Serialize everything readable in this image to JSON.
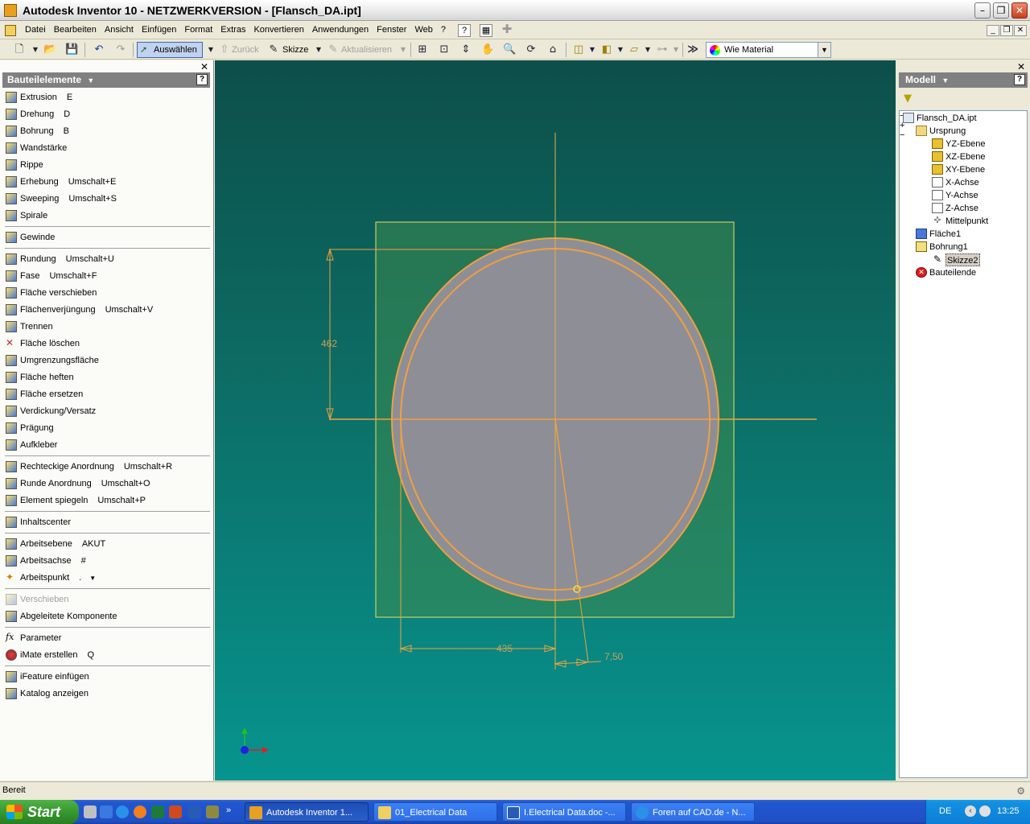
{
  "window": {
    "title": "Autodesk Inventor 10 - NETZWERKVERSION - [Flansch_DA.ipt]"
  },
  "menu": {
    "items": [
      "Datei",
      "Bearbeiten",
      "Ansicht",
      "Einfügen",
      "Format",
      "Extras",
      "Konvertieren",
      "Anwendungen",
      "Fenster",
      "Web",
      "?"
    ]
  },
  "toolbar": {
    "select_label": "Auswählen",
    "back_label": "Zurück",
    "sketch_label": "Skizze",
    "update_label": "Aktualisieren",
    "material": "Wie Material"
  },
  "left_panel": {
    "title": "Bauteilelemente",
    "items": [
      {
        "label": "Extrusion",
        "shortcut": "E"
      },
      {
        "label": "Drehung",
        "shortcut": "D"
      },
      {
        "label": "Bohrung",
        "shortcut": "B"
      },
      {
        "label": "Wandstärke",
        "shortcut": ""
      },
      {
        "label": "Rippe",
        "shortcut": ""
      },
      {
        "label": "Erhebung",
        "shortcut": "Umschalt+E"
      },
      {
        "label": "Sweeping",
        "shortcut": "Umschalt+S"
      },
      {
        "label": "Spirale",
        "shortcut": ""
      },
      {
        "label": "Gewinde",
        "shortcut": ""
      },
      {
        "label": "Rundung",
        "shortcut": "Umschalt+U"
      },
      {
        "label": "Fase",
        "shortcut": "Umschalt+F"
      },
      {
        "label": "Fläche verschieben",
        "shortcut": ""
      },
      {
        "label": "Flächenverjüngung",
        "shortcut": "Umschalt+V"
      },
      {
        "label": "Trennen",
        "shortcut": ""
      },
      {
        "label": "Fläche löschen",
        "shortcut": ""
      },
      {
        "label": "Umgrenzungsfläche",
        "shortcut": ""
      },
      {
        "label": "Fläche heften",
        "shortcut": ""
      },
      {
        "label": "Fläche ersetzen",
        "shortcut": ""
      },
      {
        "label": "Verdickung/Versatz",
        "shortcut": ""
      },
      {
        "label": "Prägung",
        "shortcut": ""
      },
      {
        "label": "Aufkleber",
        "shortcut": ""
      },
      {
        "label": "Rechteckige Anordnung",
        "shortcut": "Umschalt+R"
      },
      {
        "label": "Runde Anordnung",
        "shortcut": "Umschalt+O"
      },
      {
        "label": "Element spiegeln",
        "shortcut": "Umschalt+P"
      },
      {
        "label": "Inhaltscenter",
        "shortcut": ""
      },
      {
        "label": "Arbeitsebene",
        "shortcut": "AKUT"
      },
      {
        "label": "Arbeitsachse",
        "shortcut": "#"
      },
      {
        "label": "Arbeitspunkt",
        "shortcut": "."
      },
      {
        "label": "Verschieben",
        "shortcut": ""
      },
      {
        "label": "Abgeleitete Komponente",
        "shortcut": ""
      },
      {
        "label": "Parameter",
        "shortcut": ""
      },
      {
        "label": "iMate erstellen",
        "shortcut": "Q"
      },
      {
        "label": "iFeature einfügen",
        "shortcut": ""
      },
      {
        "label": "Katalog anzeigen",
        "shortcut": ""
      }
    ]
  },
  "viewport": {
    "dimensions": {
      "vertical": "462",
      "horizontal": "435",
      "offset": "7,50"
    }
  },
  "model_panel": {
    "title": "Modell",
    "tree": [
      {
        "label": "Flansch_DA.ipt"
      },
      {
        "label": "Ursprung"
      },
      {
        "label": "YZ-Ebene"
      },
      {
        "label": "XZ-Ebene"
      },
      {
        "label": "XY-Ebene"
      },
      {
        "label": "X-Achse"
      },
      {
        "label": "Y-Achse"
      },
      {
        "label": "Z-Achse"
      },
      {
        "label": "Mittelpunkt"
      },
      {
        "label": "Fläche1"
      },
      {
        "label": "Bohrung1"
      },
      {
        "label": "Skizze2"
      },
      {
        "label": "Bauteilende"
      }
    ]
  },
  "status": {
    "text": "Bereit"
  },
  "taskbar": {
    "start": "Start",
    "tasks": [
      "Autodesk Inventor 1...",
      "01_Electrical Data",
      "I.Electrical Data.doc -...",
      "Foren auf CAD.de - N..."
    ],
    "language": "DE",
    "clock": "13:25"
  },
  "colors": {
    "sketch_orange": "#f0a040",
    "sketch_yellow": "#e8e060",
    "face_gray": "#8e8e96",
    "plane_green": "#3c8a50"
  }
}
